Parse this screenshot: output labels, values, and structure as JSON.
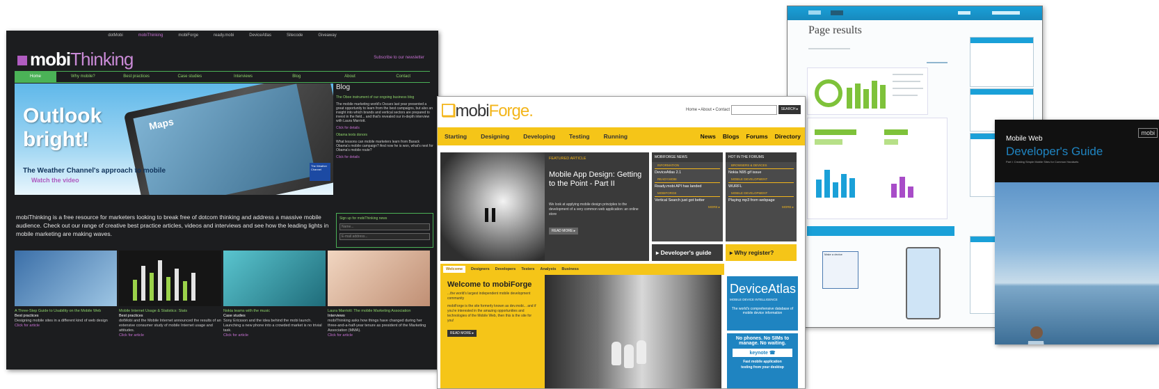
{
  "mobithinking": {
    "topnav": [
      "dotMobi",
      "mobiThinking",
      "mobiForge",
      "ready.mobi",
      "DeviceAtlas",
      "Sitecode",
      "Giveaway"
    ],
    "logo_main": "mobi",
    "logo_thin": "Thinking",
    "subscribe": "Subscribe to our newsletter",
    "nav": [
      "Home",
      "Why mobile?",
      "Best practices",
      "Case studies",
      "Interviews",
      "Blog",
      "About",
      "Contact"
    ],
    "hero": {
      "headline": "Outlook bright!",
      "maps_label": "Maps",
      "subline": "The Weather Channel's approach to mobile",
      "watch": "Watch the video",
      "badge": "The Weather Channel"
    },
    "blog": {
      "title": "Blog",
      "items": [
        {
          "link": "The Oboe instrument of our ongoing business blog",
          "text": "The mobile marketing world's Oscars last year presented a great opportunity to learn from the best campaigns, but also an insight into which brands and vertical sectors are prepared to invest in the field... and that's revealed our in-depth interview with Laura Marriott.",
          "more": "Click for details"
        },
        {
          "link": "Obama texts donors",
          "text": "What lessons can mobile marketers learn from Barack Obama's mobile campaign? And now he is won, what's next for Obama's mobile route?",
          "more": "Click for details"
        }
      ],
      "signup_title": "Sign up for mobiThinking news",
      "field_name": "Name...",
      "field_email": "E-mail address...",
      "go": "Go"
    },
    "intro": "mobiThinking is a free resource for marketers looking to break free of dotcom thinking and address a massive mobile audience. Check out our range of creative best practice articles, videos and interviews and see how the leading lights in mobile marketing are making waves.",
    "features": [
      {
        "head": "A Three-Step Guide to Usability on the Mobile Web",
        "type": "Best practices",
        "text": "Designing mobile sites in a different kind of web design",
        "more": "Click for article"
      },
      {
        "head": "Mobile Internet Usage & Statistics: Stats",
        "type": "Best practices",
        "text": "dotMobi and the Mobile Internet announced the results of an extensive consumer study of mobile Internet usage and attitudes.",
        "more": "Click for article"
      },
      {
        "head": "Nokia teams with the music",
        "type": "Case studies",
        "text": "Sony Ericsson and the idea behind the mobi launch. Launching a new phone into a crowded market is no trivial task.",
        "more": "Click for article"
      },
      {
        "head": "Laura Marriott: The mobile Marketing Association",
        "type": "Interviews",
        "text": "mobiThinking asks how things have changed during her three-and-a-half-year tenure as president of the Marketing Association (MMA).",
        "more": "Click for article"
      }
    ]
  },
  "mobiforge": {
    "logo_main": "mobi",
    "logo_accent": "Forge.",
    "util": "Home  ▪  About  ▪  Contact",
    "search_button": "SEARCH ▸",
    "nav_left": [
      "Starting",
      "Designing",
      "Developing",
      "Testing",
      "Running"
    ],
    "nav_right": [
      "News",
      "Blogs",
      "Forums",
      "Directory"
    ],
    "featured": {
      "label": "FEATURED ARTICLE",
      "title": "Mobile App Design: Getting to the Point - Part II",
      "text": "We look at applying mobile design principles to the development of a very common web application: an online store",
      "more": "READ MORE ▸"
    },
    "news": {
      "header": "MOBIFORGE NEWS",
      "items": [
        {
          "cat": "INFORMATION",
          "title": "DeviceAtlas 2.1"
        },
        {
          "cat": "READY.MOBI",
          "title": "Ready.mobi API has landed"
        },
        {
          "cat": "MOBIFORGE",
          "title": "Vertical Search just got better"
        }
      ],
      "more": "MORE ▸"
    },
    "forums": {
      "header": "HOT IN THE FORUMS",
      "items": [
        {
          "cat": "BROWSERS & DEVICES",
          "title": "Nokia N95 gif issue"
        },
        {
          "cat": "MOBILE DEVELOPMENT",
          "title": "WURFL"
        },
        {
          "cat": "MOBILE DEVELOPMENT",
          "title": "Playing mp3 from webpage"
        }
      ],
      "more": "MORE ▸"
    },
    "dev_guide": "▸ Developer's guide",
    "why_register": "▸ Why register?",
    "tabs": [
      "Welcome",
      "Designers",
      "Developers",
      "Testers",
      "Analysts",
      "Business"
    ],
    "welcome": {
      "title": "Welcome to mobiForge",
      "tagline": "...the world's largest independent mobile development community",
      "text": "mobiForge is the site formerly known as dev.mobi... and if you're interested in the amazing opportunities and technologies of the Mobile Web, then this is the site for you!",
      "more": "READ MORE ▸"
    },
    "deviceatlas": {
      "name": "DeviceAtlas",
      "tag": "MOBILE DEVICE INTELLIGENCE",
      "desc": "The world's comprehensive database of mobile device information"
    },
    "keynote": {
      "line1": "No phones. No SIMs to",
      "line2": "manage. No waiting.",
      "brand": "keynote ☎",
      "line3": "Fast mobile application",
      "line4": "testing from your desktop"
    }
  },
  "page_results": {
    "title": "Page results",
    "table_title": "Make a device"
  },
  "devguide": {
    "subtitle_top": "Mobile Web",
    "title": "Developer's Guide",
    "tagline": "Part I: Creating Simple Mobile Sites for Common Handsets",
    "brand": "mobi"
  }
}
